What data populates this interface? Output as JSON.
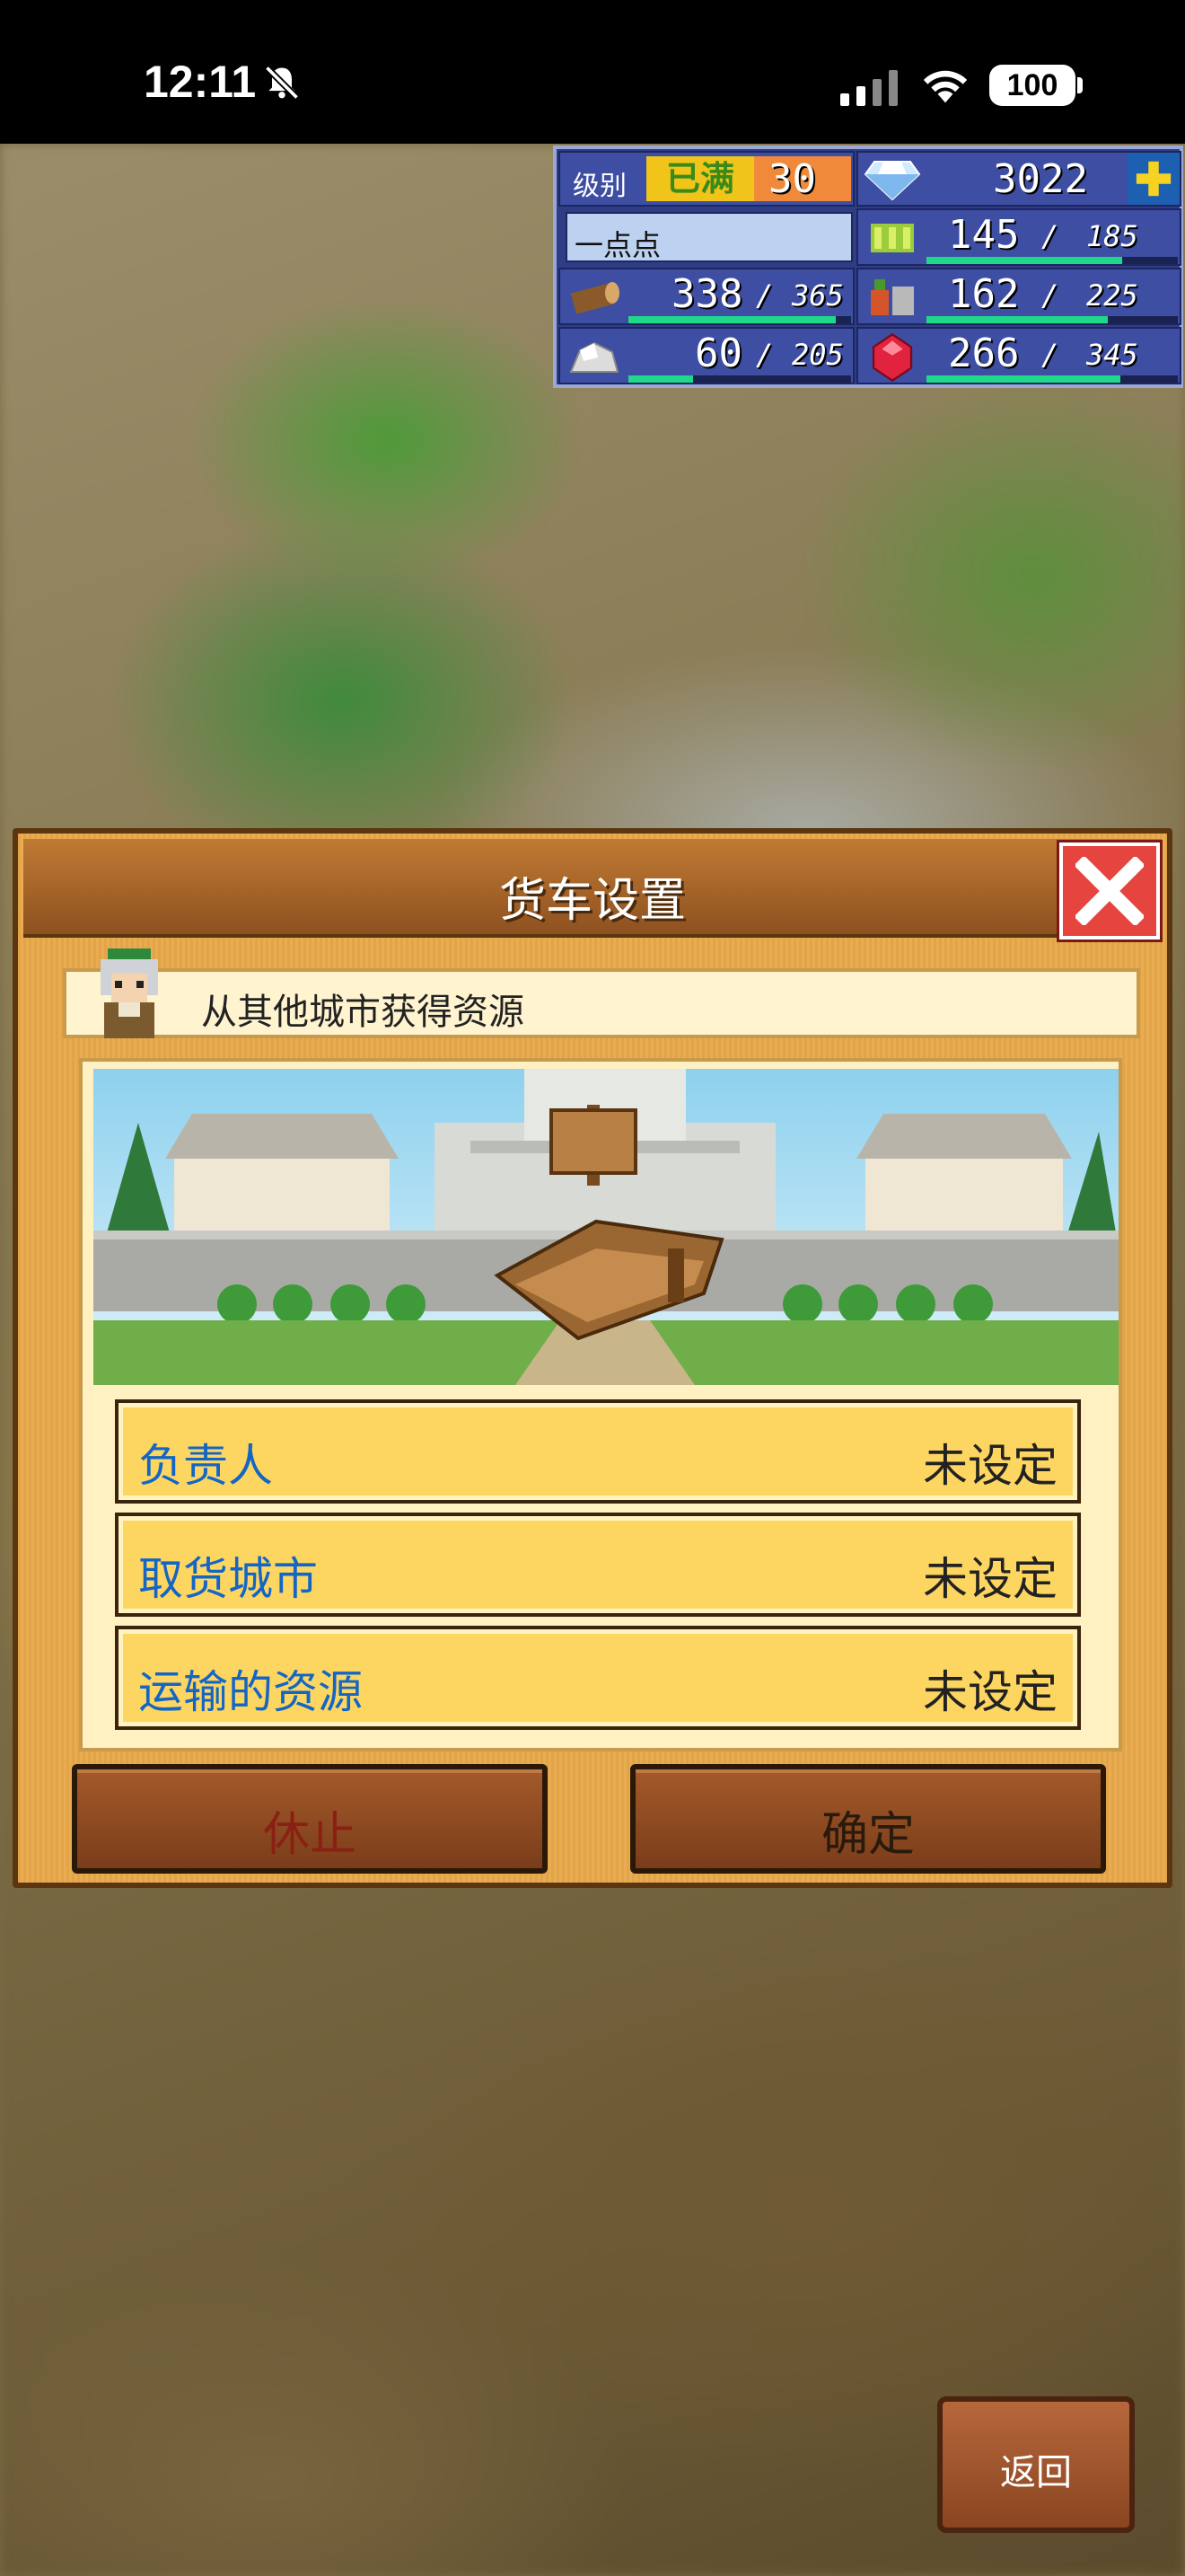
{
  "status_bar": {
    "time": "12:11",
    "battery": "100"
  },
  "hud": {
    "level_label": "级别",
    "level_badge": "已满",
    "level_value": "30",
    "diamond_value": "3022",
    "town_name": "一点点",
    "resources": [
      {
        "name": "wheat",
        "value": "145",
        "max": "185",
        "fill": 0.78
      },
      {
        "name": "wood",
        "value": "338",
        "max": "365",
        "fill": 0.93
      },
      {
        "name": "vegetables",
        "value": "162",
        "max": "225",
        "fill": 0.72
      },
      {
        "name": "stone",
        "value": "60",
        "max": "205",
        "fill": 0.29
      },
      {
        "name": "ruby",
        "value": "266",
        "max": "345",
        "fill": 0.77
      }
    ],
    "separator": "/"
  },
  "dialog": {
    "title": "货车设置",
    "subtitle": "从其他城市获得资源",
    "rows": [
      {
        "label": "负责人",
        "value": "未设定"
      },
      {
        "label": "取货城市",
        "value": "未设定"
      },
      {
        "label": "运输的资源",
        "value": "未设定"
      }
    ],
    "pause_button": "休止",
    "confirm_button": "确定"
  },
  "back_button": "返回",
  "colors": {
    "row_label": "#1366c5",
    "pause_label": "#8a1f14",
    "confirm_label": "#2a1a0c",
    "bar_fill": "#1fd88a"
  }
}
